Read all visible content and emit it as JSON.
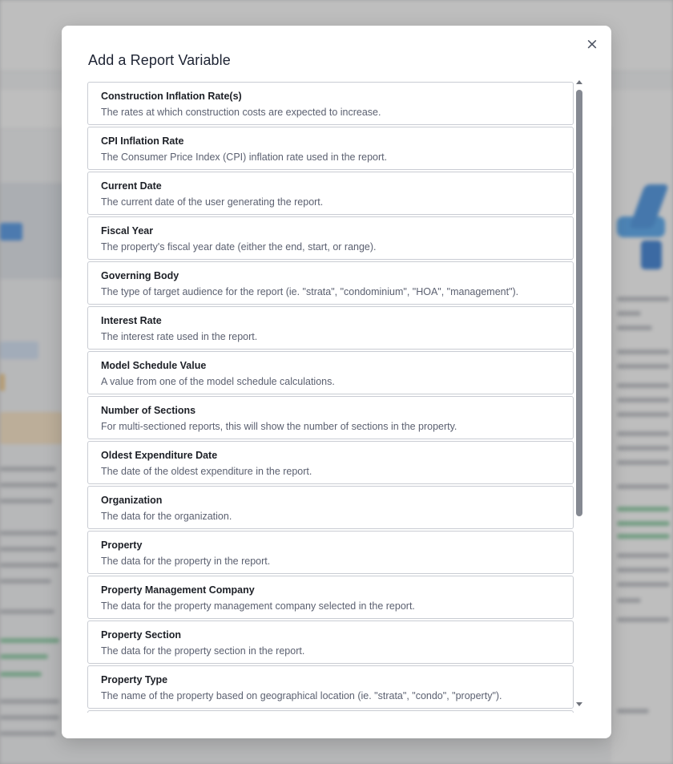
{
  "modal": {
    "title": "Add a Report Variable",
    "close_symbol": "×"
  },
  "variables": [
    {
      "name": "Construction Inflation Rate(s)",
      "description": "The rates at which construction costs are expected to increase."
    },
    {
      "name": "CPI Inflation Rate",
      "description": "The Consumer Price Index (CPI) inflation rate used in the report."
    },
    {
      "name": "Current Date",
      "description": "The current date of the user generating the report."
    },
    {
      "name": "Fiscal Year",
      "description": "The property's fiscal year date (either the end, start, or range)."
    },
    {
      "name": "Governing Body",
      "description": "The type of target audience for the report (ie. \"strata\", \"condominium\", \"HOA\", \"management\")."
    },
    {
      "name": "Interest Rate",
      "description": "The interest rate used in the report."
    },
    {
      "name": "Model Schedule Value",
      "description": "A value from one of the model schedule calculations."
    },
    {
      "name": "Number of Sections",
      "description": "For multi-sectioned reports, this will show the number of sections in the property."
    },
    {
      "name": "Oldest Expenditure Date",
      "description": "The date of the oldest expenditure in the report."
    },
    {
      "name": "Organization",
      "description": "The data for the organization."
    },
    {
      "name": "Property",
      "description": "The data for the property in the report."
    },
    {
      "name": "Property Management Company",
      "description": "The data for the property management company selected in the report."
    },
    {
      "name": "Property Section",
      "description": "The data for the property section in the report."
    },
    {
      "name": "Property Type",
      "description": "The name of the property based on geographical location (ie. \"strata\", \"condo\", \"property\")."
    }
  ],
  "colors": {
    "accent": "#2f86e0",
    "title_text": "#1d2333",
    "description_text": "#5b6070",
    "item_border": "#c9ccd3"
  }
}
